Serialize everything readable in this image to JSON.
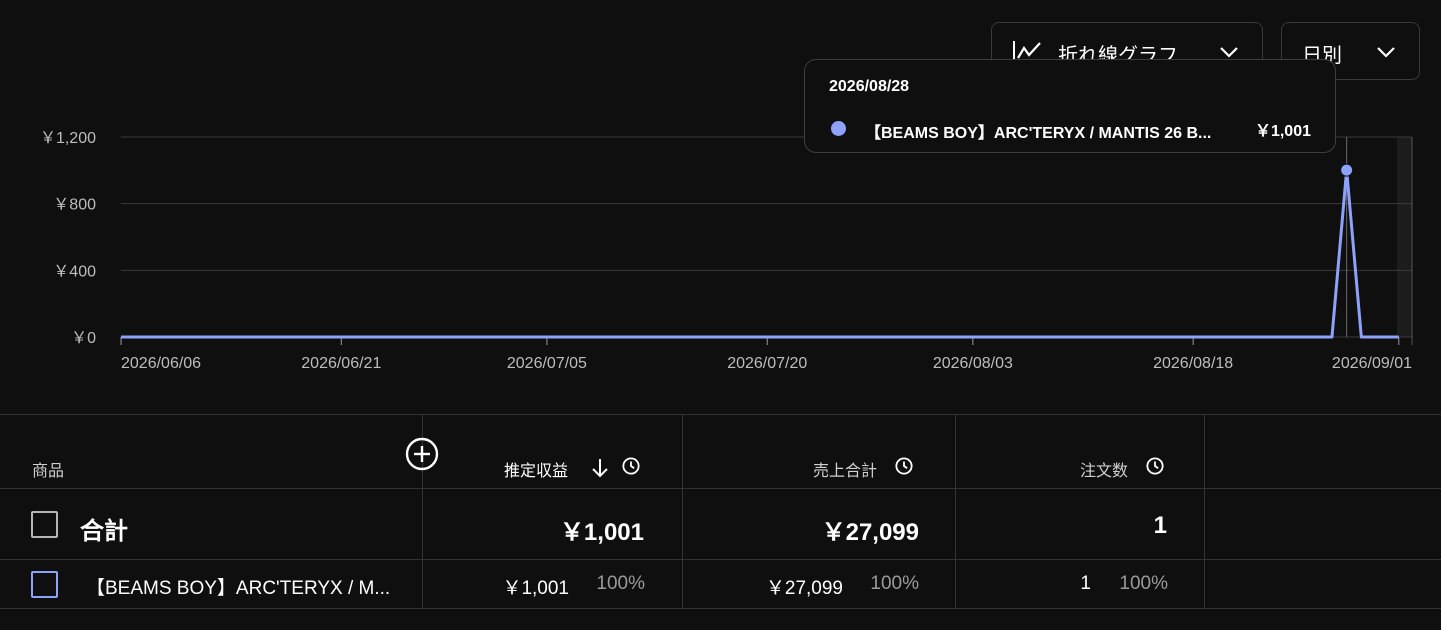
{
  "controls": {
    "chart_type": "折れ線グラフ",
    "period": "日別"
  },
  "tooltip": {
    "date": "2026/08/28",
    "product": "【BEAMS BOY】ARC'TERYX / MANTIS 26 B...",
    "value": "￥1,001"
  },
  "colors": {
    "series": "#8ea2fb",
    "background": "#0f0f0f",
    "grid": "#3a3a3a"
  },
  "chart_data": {
    "type": "line",
    "x_tick_labels": [
      "2026/06/06",
      "2026/06/21",
      "2026/07/05",
      "2026/07/20",
      "2026/08/03",
      "2026/08/18",
      "2026/09/01"
    ],
    "y_tick_labels": [
      "￥1,200",
      "￥800",
      "￥400",
      "￥0"
    ],
    "y_ticks": [
      1200,
      800,
      400,
      0
    ],
    "ylim": [
      0,
      1200
    ],
    "x_start": "2026/06/06",
    "x_end": "2026/09/01",
    "series": [
      {
        "points": [
          {
            "x": "2026/06/06",
            "y": 0
          },
          {
            "x": "2026/08/27",
            "y": 0
          },
          {
            "x": "2026/08/28",
            "y": 1001
          },
          {
            "x": "2026/08/29",
            "y": 0
          },
          {
            "x": "2026/09/01",
            "y": 0
          }
        ]
      }
    ],
    "highlight_x": "2026/08/28"
  },
  "table": {
    "headers": {
      "product": "商品",
      "revenue": "推定収益",
      "sales": "売上合計",
      "orders": "注文数"
    },
    "total": {
      "label": "合計",
      "revenue": "￥1,001",
      "sales": "￥27,099",
      "orders": "1"
    },
    "rows": [
      {
        "product": "【BEAMS BOY】ARC'TERYX / M...",
        "revenue": "￥1,001",
        "revenue_pct": "100%",
        "sales": "￥27,099",
        "sales_pct": "100%",
        "orders": "1",
        "orders_pct": "100%"
      }
    ]
  }
}
